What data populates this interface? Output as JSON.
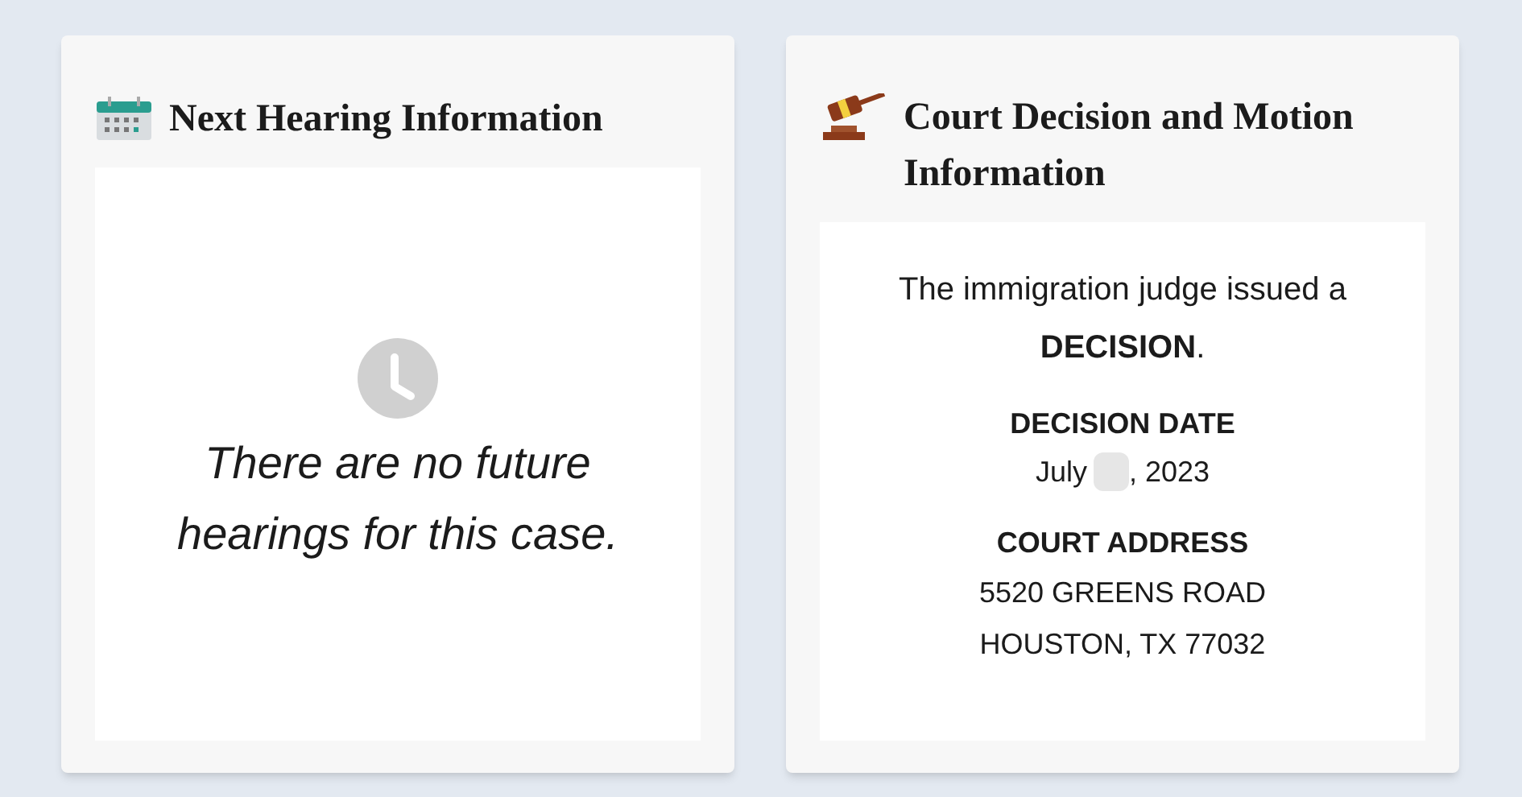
{
  "hearing_card": {
    "title": "Next Hearing Information",
    "message": "There are no future hearings for this case."
  },
  "decision_card": {
    "title": "Court Decision and Motion Information",
    "intro": "The immigration judge issued a **DECISION**.",
    "sections": [
      {
        "heading": "DECISION DATE",
        "kind": "redacted-date",
        "before": "July",
        "after": ", 2023"
      },
      {
        "heading": "COURT ADDRESS",
        "kind": "lines",
        "lines": [
          "5520 GREENS ROAD",
          "HOUSTON, TX 77032"
        ]
      }
    ]
  }
}
